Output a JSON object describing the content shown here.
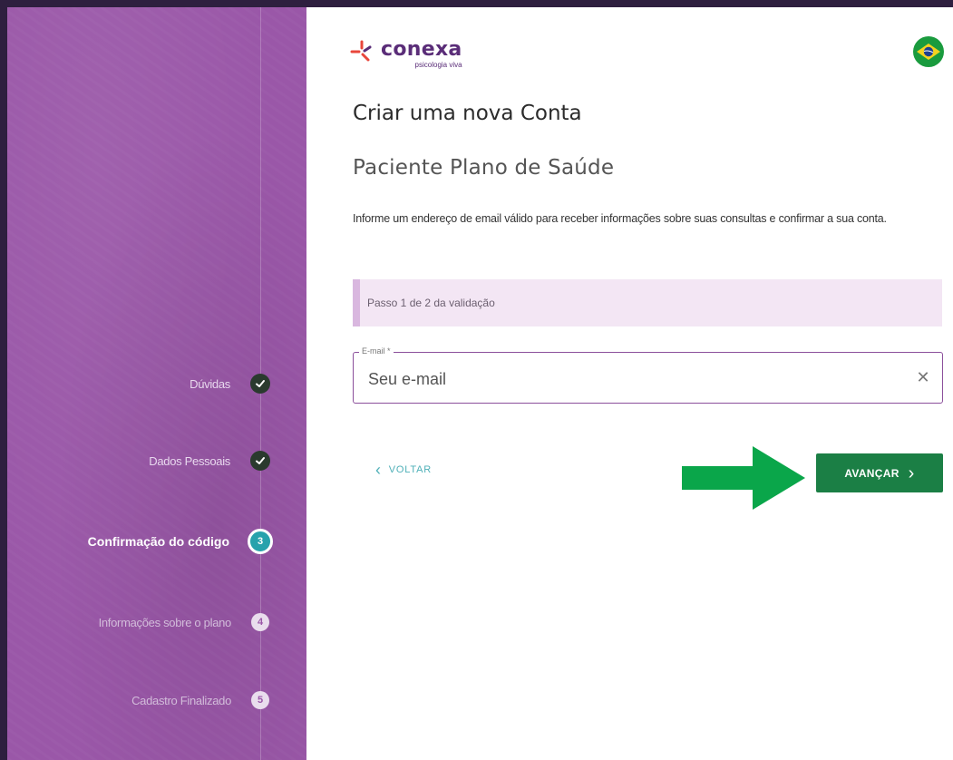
{
  "sidebar": {
    "steps": [
      {
        "label": "Dúvidas",
        "state": "done",
        "icon": "check-icon"
      },
      {
        "label": "Dados Pessoais",
        "state": "done",
        "icon": "check-icon"
      },
      {
        "label": "Confirmação do código",
        "state": "current",
        "number": "3"
      },
      {
        "label": "Informações sobre o plano",
        "state": "pending",
        "number": "4"
      },
      {
        "label": "Cadastro Finalizado",
        "state": "pending",
        "number": "5"
      }
    ]
  },
  "brand": {
    "name": "conexa",
    "tagline": "psicologia viva",
    "color": "#5a2d78",
    "accent": "#e8463b",
    "language_icon": "brazil-flag-icon"
  },
  "form": {
    "title": "Criar uma nova Conta",
    "subtitle": "Paciente Plano de Saúde",
    "description": "Informe um endereço de email válido para receber informações sobre suas consultas e confirmar a sua conta.",
    "step_banner": "Passo 1 de 2 da validação",
    "email": {
      "label": "E-mail *",
      "placeholder": "Seu e-mail",
      "value": ""
    },
    "back_label": "VOLTAR",
    "next_label": "AVANÇAR"
  },
  "colors": {
    "sidebar_bg": "#9a57a8",
    "primary_button": "#1b7f45",
    "current_step": "#27a2ac",
    "annotation_arrow": "#0aa64a"
  }
}
